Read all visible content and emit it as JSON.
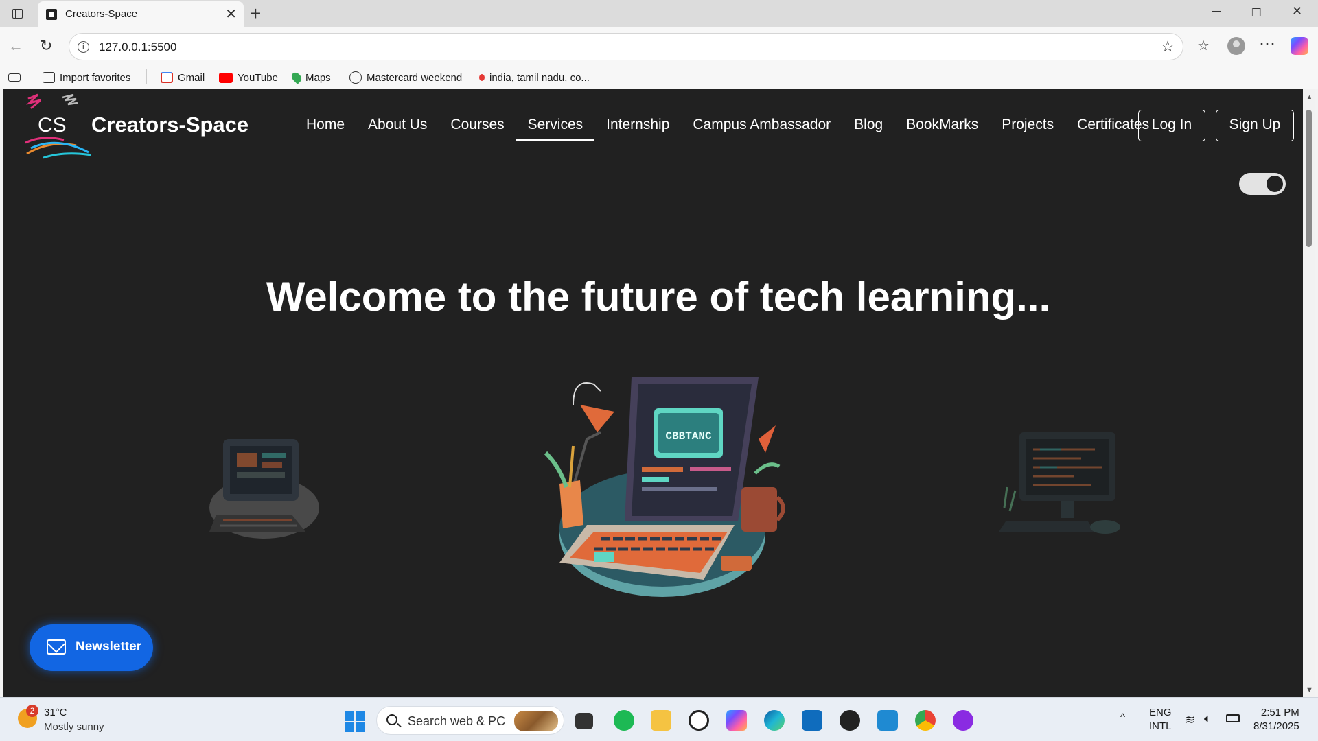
{
  "browser": {
    "tab_title": "Creators-Space",
    "url": "127.0.0.1:5500",
    "favorites": [
      {
        "label": "Import favorites",
        "icon": "import-icon"
      },
      {
        "label": "Gmail",
        "icon": "gmail-icon"
      },
      {
        "label": "YouTube",
        "icon": "youtube-icon"
      },
      {
        "label": "Maps",
        "icon": "maps-icon"
      },
      {
        "label": "Mastercard weekend",
        "icon": "globe-icon"
      },
      {
        "label": "india, tamil nadu, co...",
        "icon": "location-pin-icon"
      }
    ]
  },
  "site": {
    "logo_text": "CS",
    "brand": "Creators-Space",
    "nav": [
      "Home",
      "About Us",
      "Courses",
      "Services",
      "Internship",
      "Campus Ambassador",
      "Blog",
      "BookMarks",
      "Projects",
      "Certificates"
    ],
    "active_nav": "Services",
    "login_label": "Log In",
    "signup_label": "Sign Up",
    "hero_title": "Welcome to the future of tech learning...",
    "screen_text": "CBBTANC",
    "newsletter_label": "Newsletter",
    "theme_toggle_state": "dark"
  },
  "taskbar": {
    "weather_badge": "2",
    "temperature": "31°C",
    "condition": "Mostly sunny",
    "search_placeholder": "Search web & PC",
    "lang_top": "ENG",
    "lang_bottom": "INTL",
    "time": "2:51 PM",
    "date": "8/31/2025"
  },
  "colors": {
    "page_bg": "#212121",
    "accent_blue": "#1266e3",
    "nav_text": "#ffffff"
  }
}
